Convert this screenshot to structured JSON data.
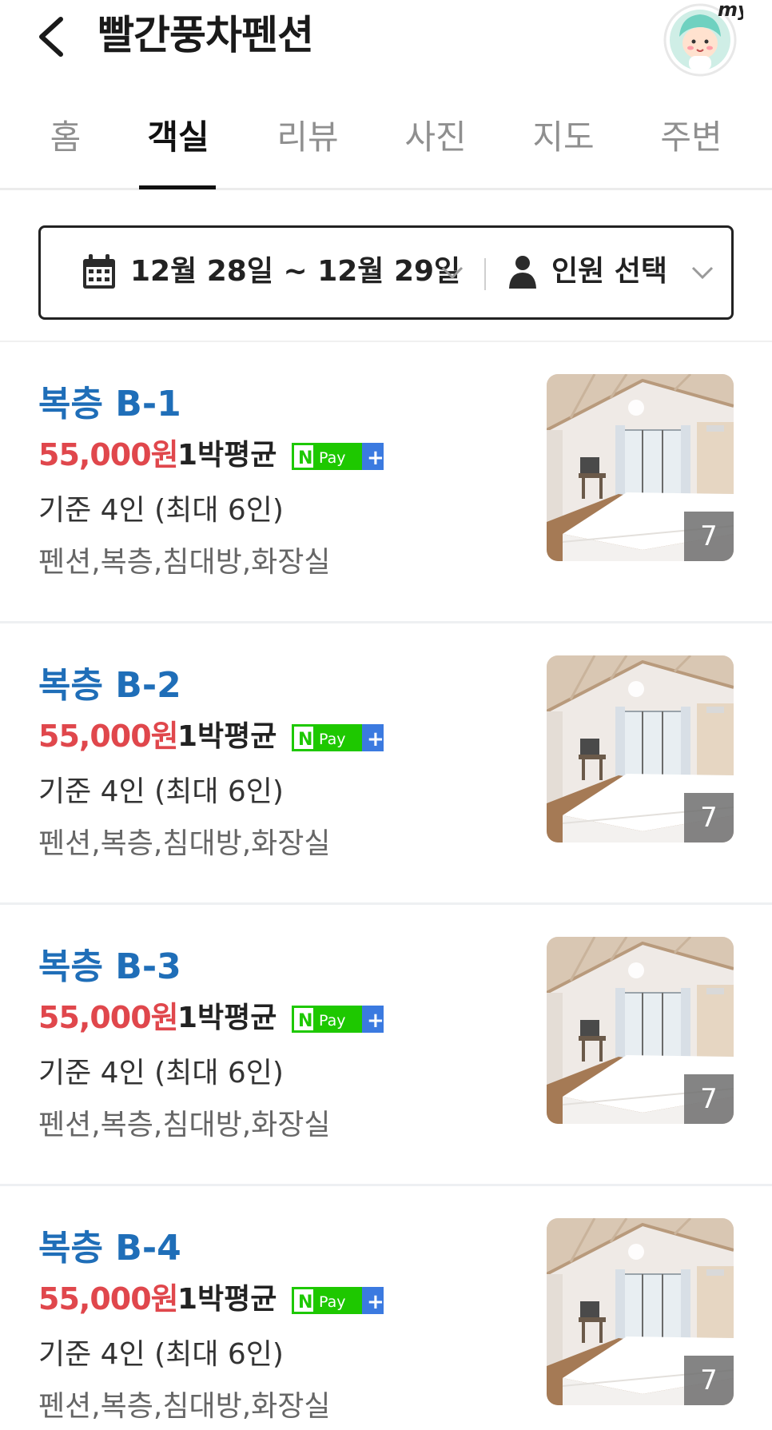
{
  "header": {
    "title": "빨간풍차펜션",
    "back_icon": "chevron-left-icon",
    "avatar_label": "my"
  },
  "tabs": [
    {
      "label": "홈",
      "active": false
    },
    {
      "label": "객실",
      "active": true
    },
    {
      "label": "리뷰",
      "active": false
    },
    {
      "label": "사진",
      "active": false
    },
    {
      "label": "지도",
      "active": false
    },
    {
      "label": "주변",
      "active": false
    }
  ],
  "filter": {
    "date_range": "12월 28일 ~ 12월 29일",
    "guest_label": "인원 선택",
    "calendar_icon": "calendar-icon",
    "person_icon": "person-icon"
  },
  "rooms": [
    {
      "name": "복층 B-1",
      "price": "55,000원",
      "price_unit": "1박평균",
      "capacity": "기준 4인 (최대 6인)",
      "features": "펜션,복층,침대방,화장실",
      "photo_count": "7"
    },
    {
      "name": "복층 B-2",
      "price": "55,000원",
      "price_unit": "1박평균",
      "capacity": "기준 4인 (최대 6인)",
      "features": "펜션,복층,침대방,화장실",
      "photo_count": "7"
    },
    {
      "name": "복층 B-3",
      "price": "55,000원",
      "price_unit": "1박평균",
      "capacity": "기준 4인 (최대 6인)",
      "features": "펜션,복층,침대방,화장실",
      "photo_count": "7"
    },
    {
      "name": "복층 B-4",
      "price": "55,000원",
      "price_unit": "1박평균",
      "capacity": "기준 4인 (최대 6인)",
      "features": "펜션,복층,침대방,화장실",
      "photo_count": "7"
    }
  ],
  "npay": {
    "n": "N",
    "pay": "Pay",
    "plus": "+"
  },
  "colors": {
    "room_name": "#1f6eb8",
    "price": "#e0474c",
    "npay_green": "#1ec800",
    "npay_blue": "#3b7ae0"
  }
}
